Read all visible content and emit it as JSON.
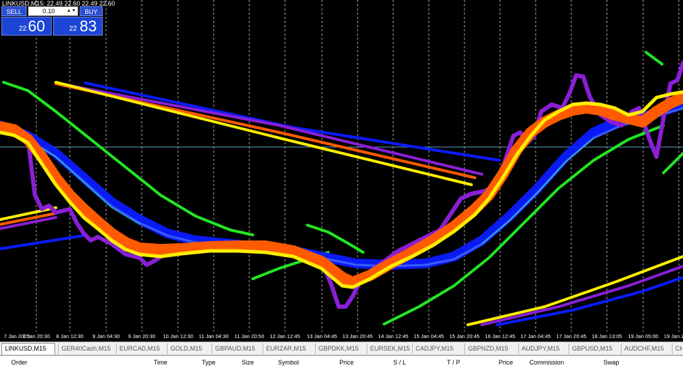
{
  "window": {
    "title": "LINKUSD,M15",
    "ohlc": "22.49 22.60 22.49 22.60"
  },
  "trade_panel": {
    "sell_label": "SELL",
    "buy_label": "BUY",
    "lot": "0.10",
    "bid_small": "22",
    "bid_big": "60",
    "ask_small": "22",
    "ask_big": "83",
    "button_color": "#2a4fd1"
  },
  "time_axis": [
    "7 Jan 2025",
    "7 Jan 20:30",
    "8 Jan 12:30",
    "9 Jan 04:30",
    "9 Jan 20:30",
    "10 Jan 12:30",
    "11 Jan 04:30",
    "11 Jan 20:50",
    "12 Jan 12:45",
    "13 Jan 04:45",
    "13 Jan 20:45",
    "14 Jan 12:45",
    "15 Jan 04:45",
    "15 Jan 20:45",
    "16 Jan 12:45",
    "17 Jan 04:45",
    "17 Jan 20:45",
    "18 Jan 13:05",
    "19 Jan 05:00",
    "19 Jan 2"
  ],
  "tabs": [
    "LINKUSD,M15",
    "GER40Cash,M15",
    "EURCAD,M15",
    "GOLD,M15",
    "GBPAUD,M15",
    "EURZAR,M15",
    "GBPDKK,M15",
    "EURSEK,M15",
    "CADJPY,M15",
    "GBPNZD,M15",
    "AUDJPY,M15",
    "GBPUSD,M15",
    "AUDCHF,M15",
    "CH"
  ],
  "terminal_columns": [
    "Order",
    "Time",
    "Type",
    "Size",
    "Symbol",
    "Price",
    "S / L",
    "T / P",
    "Price",
    "Commission",
    "Swap"
  ],
  "colors": {
    "green": "#22e622",
    "blue": "#0a1cff",
    "purple": "#8a1fd6",
    "orange": "#ff5a00",
    "yellow": "#ffee00",
    "grid": "#ffffff"
  }
}
